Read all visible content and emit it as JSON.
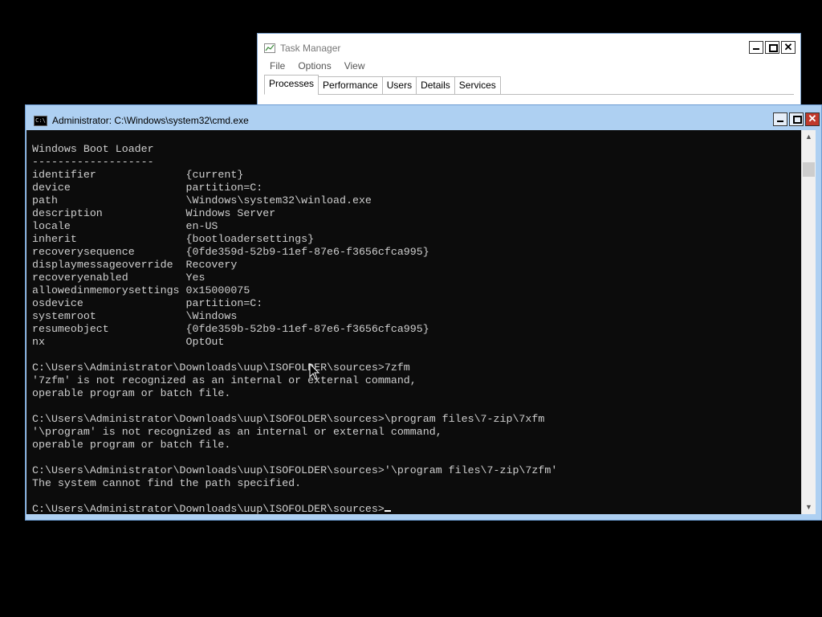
{
  "task_manager": {
    "title": "Task Manager",
    "menu": [
      "File",
      "Options",
      "View"
    ],
    "tabs": [
      "Processes",
      "Performance",
      "Users",
      "Details",
      "Services"
    ],
    "active_tab": "Processes",
    "close_glyph": "✕"
  },
  "cmd": {
    "title": "Administrator: C:\\Windows\\system32\\cmd.exe",
    "close_glyph": "✕",
    "lines": [
      "Windows Boot Loader",
      "-------------------",
      "identifier              {current}",
      "device                  partition=C:",
      "path                    \\Windows\\system32\\winload.exe",
      "description             Windows Server",
      "locale                  en-US",
      "inherit                 {bootloadersettings}",
      "recoverysequence        {0fde359d-52b9-11ef-87e6-f3656cfca995}",
      "displaymessageoverride  Recovery",
      "recoveryenabled         Yes",
      "allowedinmemorysettings 0x15000075",
      "osdevice                partition=C:",
      "systemroot              \\Windows",
      "resumeobject            {0fde359b-52b9-11ef-87e6-f3656cfca995}",
      "nx                      OptOut",
      "",
      "C:\\Users\\Administrator\\Downloads\\uup\\ISOFOLDER\\sources>7zfm",
      "'7zfm' is not recognized as an internal or external command,",
      "operable program or batch file.",
      "",
      "C:\\Users\\Administrator\\Downloads\\uup\\ISOFOLDER\\sources>\\program files\\7-zip\\7xfm",
      "'\\program' is not recognized as an internal or external command,",
      "operable program or batch file.",
      "",
      "C:\\Users\\Administrator\\Downloads\\uup\\ISOFOLDER\\sources>'\\program files\\7-zip\\7zfm'",
      "The system cannot find the path specified.",
      ""
    ],
    "prompt": "C:\\Users\\Administrator\\Downloads\\uup\\ISOFOLDER\\sources>"
  },
  "colors": {
    "console_bg": "#0c0c0c",
    "console_text": "#cfcfcf",
    "cmd_frame": "#aed0f2",
    "close_button": "#c0392b"
  }
}
